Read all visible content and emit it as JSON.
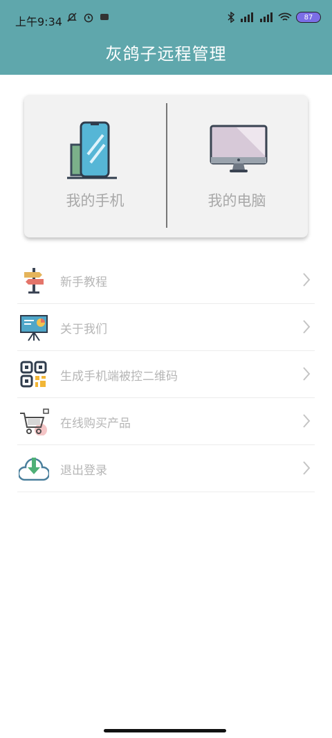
{
  "status_bar": {
    "time": "上午9:34",
    "battery": "87"
  },
  "header": {
    "title": "灰鸽子远程管理"
  },
  "devices": {
    "phone_label": "我的手机",
    "computer_label": "我的电脑"
  },
  "menu": [
    {
      "label": "新手教程",
      "icon": "signpost-icon"
    },
    {
      "label": "关于我们",
      "icon": "presentation-board-icon"
    },
    {
      "label": "生成手机端被控二维码",
      "icon": "qr-code-icon"
    },
    {
      "label": "在线购买产品",
      "icon": "shopping-cart-icon"
    },
    {
      "label": "退出登录",
      "icon": "cloud-download-icon"
    }
  ],
  "colors": {
    "header_bg": "#5fa7ac",
    "card_bg": "#f2f2f2",
    "label_gray": "#a8a8a8"
  }
}
